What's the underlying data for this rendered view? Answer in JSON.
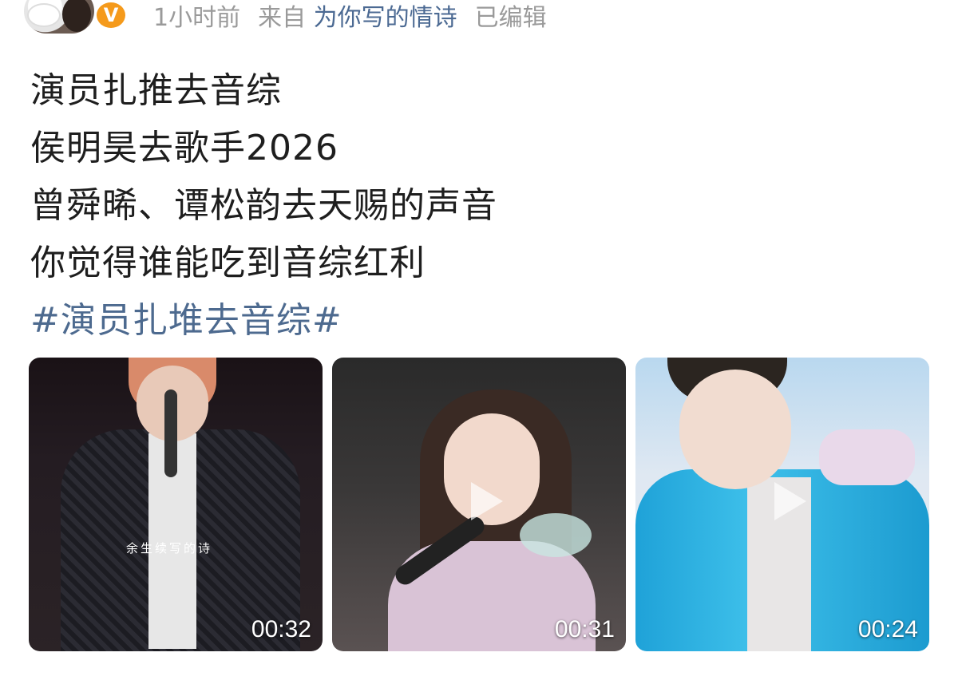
{
  "header": {
    "time": "1小时前",
    "source_prefix": "来自",
    "source_name": "为你写的情诗",
    "edited": "已编辑",
    "verified_badge": "V"
  },
  "post": {
    "lines": [
      "演员扎推去音综",
      "侯明昊去歌手2026",
      "曾舜晞、谭松韵去天赐的声音",
      "你觉得谁能吃到音综红利"
    ],
    "hashtag": "#演员扎堆去音综#"
  },
  "videos": [
    {
      "duration": "00:32",
      "caption": "余生续写的诗"
    },
    {
      "duration": "00:31"
    },
    {
      "duration": "00:24"
    }
  ],
  "colors": {
    "link": "#4d6a8f",
    "meta_gray": "#9a9a9a",
    "verified_orange": "#f59a1b"
  },
  "icons": [
    "avatar",
    "verified-badge-icon",
    "play-icon"
  ]
}
